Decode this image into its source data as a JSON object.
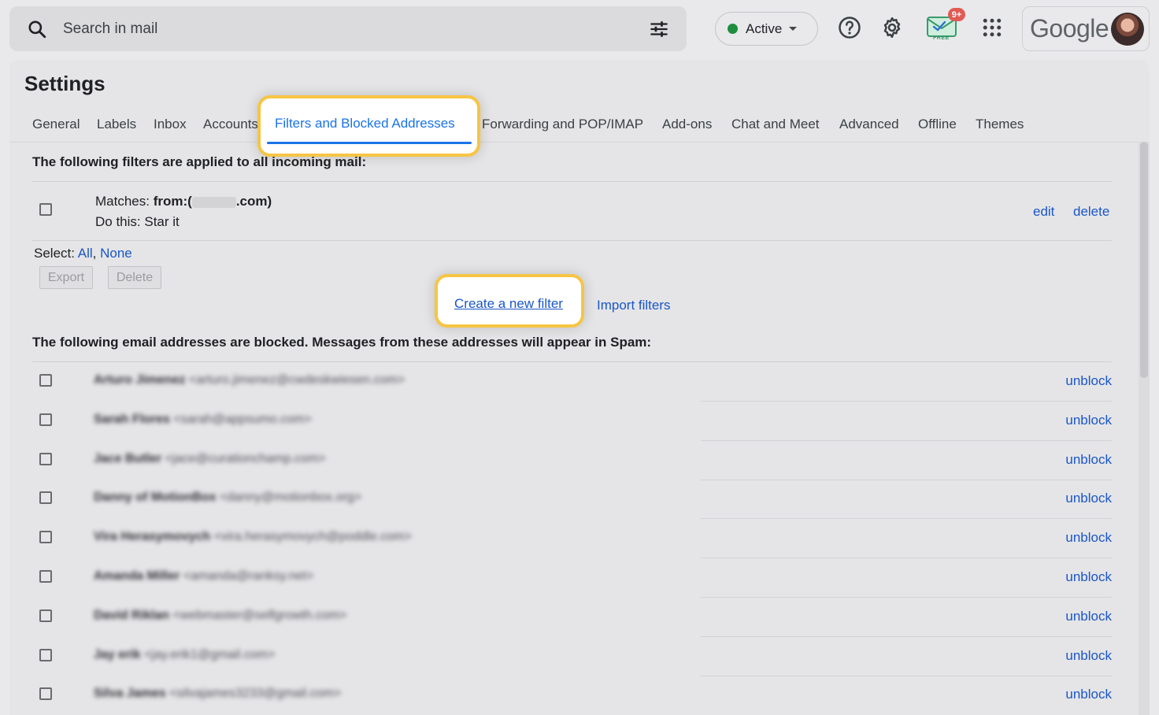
{
  "search": {
    "placeholder": "Search in mail"
  },
  "status": {
    "label": "Active",
    "color": "#1e8e3e"
  },
  "promo": {
    "badge": "9+",
    "sublabel": "FREE"
  },
  "account": {
    "logo": "Google"
  },
  "settings": {
    "title": "Settings",
    "tabs": [
      {
        "label": "General"
      },
      {
        "label": "Labels"
      },
      {
        "label": "Inbox"
      },
      {
        "label": "Accounts"
      },
      {
        "label": "Filters and Blocked Addresses",
        "active": true
      },
      {
        "label": "Forwarding and POP/IMAP"
      },
      {
        "label": "Add-ons"
      },
      {
        "label": "Chat and Meet"
      },
      {
        "label": "Advanced"
      },
      {
        "label": "Offline"
      },
      {
        "label": "Themes"
      }
    ]
  },
  "filters": {
    "heading": "The following filters are applied to all incoming mail:",
    "item": {
      "matches_label": "Matches: ",
      "matches_prefix": "from:(",
      "matches_suffix": ".com)",
      "action": "Do this: Star it",
      "edit": "edit",
      "delete": "delete"
    },
    "select_label": "Select: ",
    "select_all": "All",
    "select_none": "None",
    "export_label": "Export",
    "delete_label": "Delete",
    "create_label": "Create a new filter",
    "import_label": "Import filters"
  },
  "blocked": {
    "heading": "The following email addresses are blocked. Messages from these addresses will appear in Spam:",
    "unblock_label": "unblock",
    "rows": [
      {
        "name": "Arturo Jimenez",
        "email": "<arturo.jimenez@cwdeskwiesen.com>"
      },
      {
        "name": "Sarah Flores",
        "email": "<sarah@appsumo.com>"
      },
      {
        "name": "Jace Butler",
        "email": "<jace@curationchamp.com>"
      },
      {
        "name": "Danny of MotionBox",
        "email": "<danny@motionbox.org>"
      },
      {
        "name": "Vira Herasymovych",
        "email": "<vira.herasymovych@poddle.com>"
      },
      {
        "name": "Amanda Miller",
        "email": "<amanda@ranksy.net>"
      },
      {
        "name": "David Riklan",
        "email": "<webmaster@selfgrowth.com>"
      },
      {
        "name": "Jay erik",
        "email": "<jay.erik1@gmail.com>"
      },
      {
        "name": "Silva James",
        "email": "<silvajames3233@gmail.com>"
      }
    ]
  }
}
